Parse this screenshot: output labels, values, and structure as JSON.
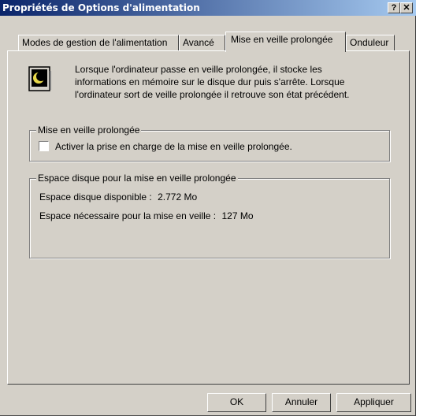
{
  "window": {
    "title": "Propriétés de Options d'alimentation",
    "help_label": "?",
    "close_label": "✕"
  },
  "tabs": [
    {
      "label": "Modes de gestion de l'alimentation",
      "active": false
    },
    {
      "label": "Avancé",
      "active": false
    },
    {
      "label": "Mise en veille prolongée",
      "active": true
    },
    {
      "label": "Onduleur",
      "active": false
    }
  ],
  "description": "Lorsque l'ordinateur passe en veille prolongée, il stocke les\ninformations en mémoire sur le disque dur puis s'arrête. Lorsque\nl'ordinateur sort de veille prolongée il retrouve son état précédent.",
  "hibernate_group": {
    "title": "Mise en veille prolongée",
    "checkbox_label": "Activer la prise en charge de la mise en veille prolongée.",
    "checked": false
  },
  "disk_group": {
    "title": "Espace disque pour la mise en veille prolongée",
    "available_label": "Espace disque disponible :",
    "available_value": "2.772 Mo",
    "required_label": "Espace nécessaire pour la mise en veille :",
    "required_value": "127 Mo"
  },
  "buttons": {
    "ok": "OK",
    "cancel": "Annuler",
    "apply": "Appliquer"
  },
  "colors": {
    "titlebar_start": "#0a246a",
    "titlebar_end": "#a6caf0",
    "face": "#d4d0c8"
  }
}
